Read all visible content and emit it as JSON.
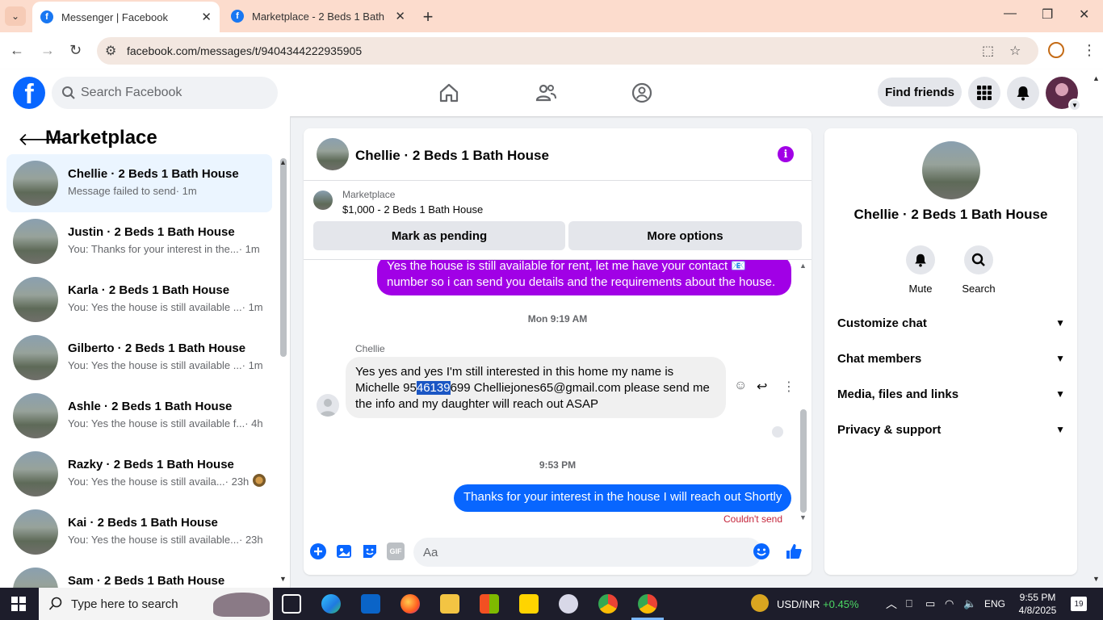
{
  "browser": {
    "tabs": [
      {
        "title": "Messenger | Facebook",
        "active": true
      },
      {
        "title": "Marketplace - 2 Beds 1 Bath House",
        "active": false
      }
    ],
    "url": "facebook.com/messages/t/9404344222935905"
  },
  "header": {
    "search_placeholder": "Search Facebook",
    "find_friends": "Find friends",
    "logo_letter": "f"
  },
  "left_panel": {
    "title": "Marketplace",
    "conversations": [
      {
        "name": "Chellie · 2 Beds 1 Bath House",
        "preview": "Message failed to send",
        "time": " · 1m",
        "active": true
      },
      {
        "name": "Justin · 2 Beds 1 Bath House",
        "preview": "You: Thanks for your interest in the...",
        "time": " · 1m"
      },
      {
        "name": "Karla · 2 Beds 1 Bath House",
        "preview": "You: Yes the house is still available ...",
        "time": " · 1m"
      },
      {
        "name": "Gilberto · 2 Beds 1 Bath House",
        "preview": "You: Yes the house is still available ...",
        "time": " · 1m"
      },
      {
        "name": "Ashle · 2 Beds 1 Bath House",
        "preview": "You: Yes the house is still available f...",
        "time": " · 4h"
      },
      {
        "name": "Razky · 2 Beds 1 Bath House",
        "preview": "You: Yes the house is still availa...",
        "time": " · 23h"
      },
      {
        "name": "Kai · 2 Beds 1 Bath House",
        "preview": "You: Yes the house is still available...",
        "time": " · 23h"
      },
      {
        "name": "Sam · 2 Beds 1 Bath House",
        "preview": "",
        "time": ""
      }
    ]
  },
  "chat": {
    "title": "Chellie · 2 Beds 1 Bath House",
    "listing": {
      "category": "Marketplace",
      "price_title": "$1,000 - 2 Beds 1 Bath House",
      "mark_pending": "Mark as pending",
      "more_options": "More options"
    },
    "messages": {
      "out_purple": "Yes the house is still available for rent, let me have your contact 📧 number so i can send you details and the requirements about the house.",
      "ts1": "Mon 9:19 AM",
      "sender": "Chellie",
      "in_part1": "Yes yes and yes I'm still interested in this home my name is Michelle 95",
      "in_highlight": "46139",
      "in_part2": "699 Chelliejones65@gmail.com please send me the info and my daughter will reach out ASAP",
      "ts2": "9:53 PM",
      "out_blue": "Thanks for your interest in the house I will reach out Shortly",
      "failed": "Couldn't send"
    },
    "composer_placeholder": "Aa",
    "gif_label": "GIF"
  },
  "info_panel": {
    "name": "Chellie · 2 Beds 1 Bath House",
    "mute": "Mute",
    "search": "Search",
    "sections": [
      "Customize chat",
      "Chat members",
      "Media, files and links",
      "Privacy & support"
    ]
  },
  "taskbar": {
    "search_text": "Type here to search",
    "ticker_name": "USD/INR",
    "ticker_change": "+0.45%",
    "language": "ENG",
    "time": "9:55 PM",
    "date": "4/8/2025",
    "notifications": "19"
  },
  "colors": {
    "fb_blue": "#0866ff",
    "purple_bubble": "#a100e6",
    "error_red": "#c4243a",
    "tabbar_bg": "#fcdccd"
  }
}
